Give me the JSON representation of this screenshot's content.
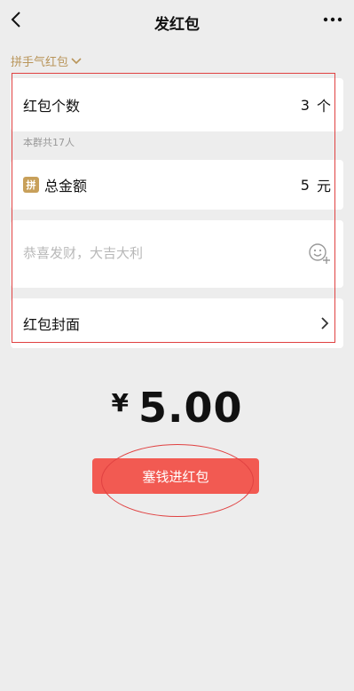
{
  "header": {
    "title": "发红包"
  },
  "type_selector": {
    "label": "拼手气红包"
  },
  "count": {
    "label": "红包个数",
    "value": "3",
    "unit": "个",
    "hint": "本群共17人"
  },
  "total": {
    "badge": "拼",
    "label": "总金额",
    "value": "5",
    "unit": "元"
  },
  "message": {
    "placeholder": "恭喜发财，大吉大利"
  },
  "cover": {
    "label": "红包封面"
  },
  "amount": {
    "currency": "¥",
    "value": "5.00"
  },
  "submit": {
    "label": "塞钱进红包"
  },
  "colors": {
    "accent_gold": "#b9955a",
    "button_red": "#f25a52",
    "annotation_red": "#e04141",
    "background": "#ededed"
  }
}
